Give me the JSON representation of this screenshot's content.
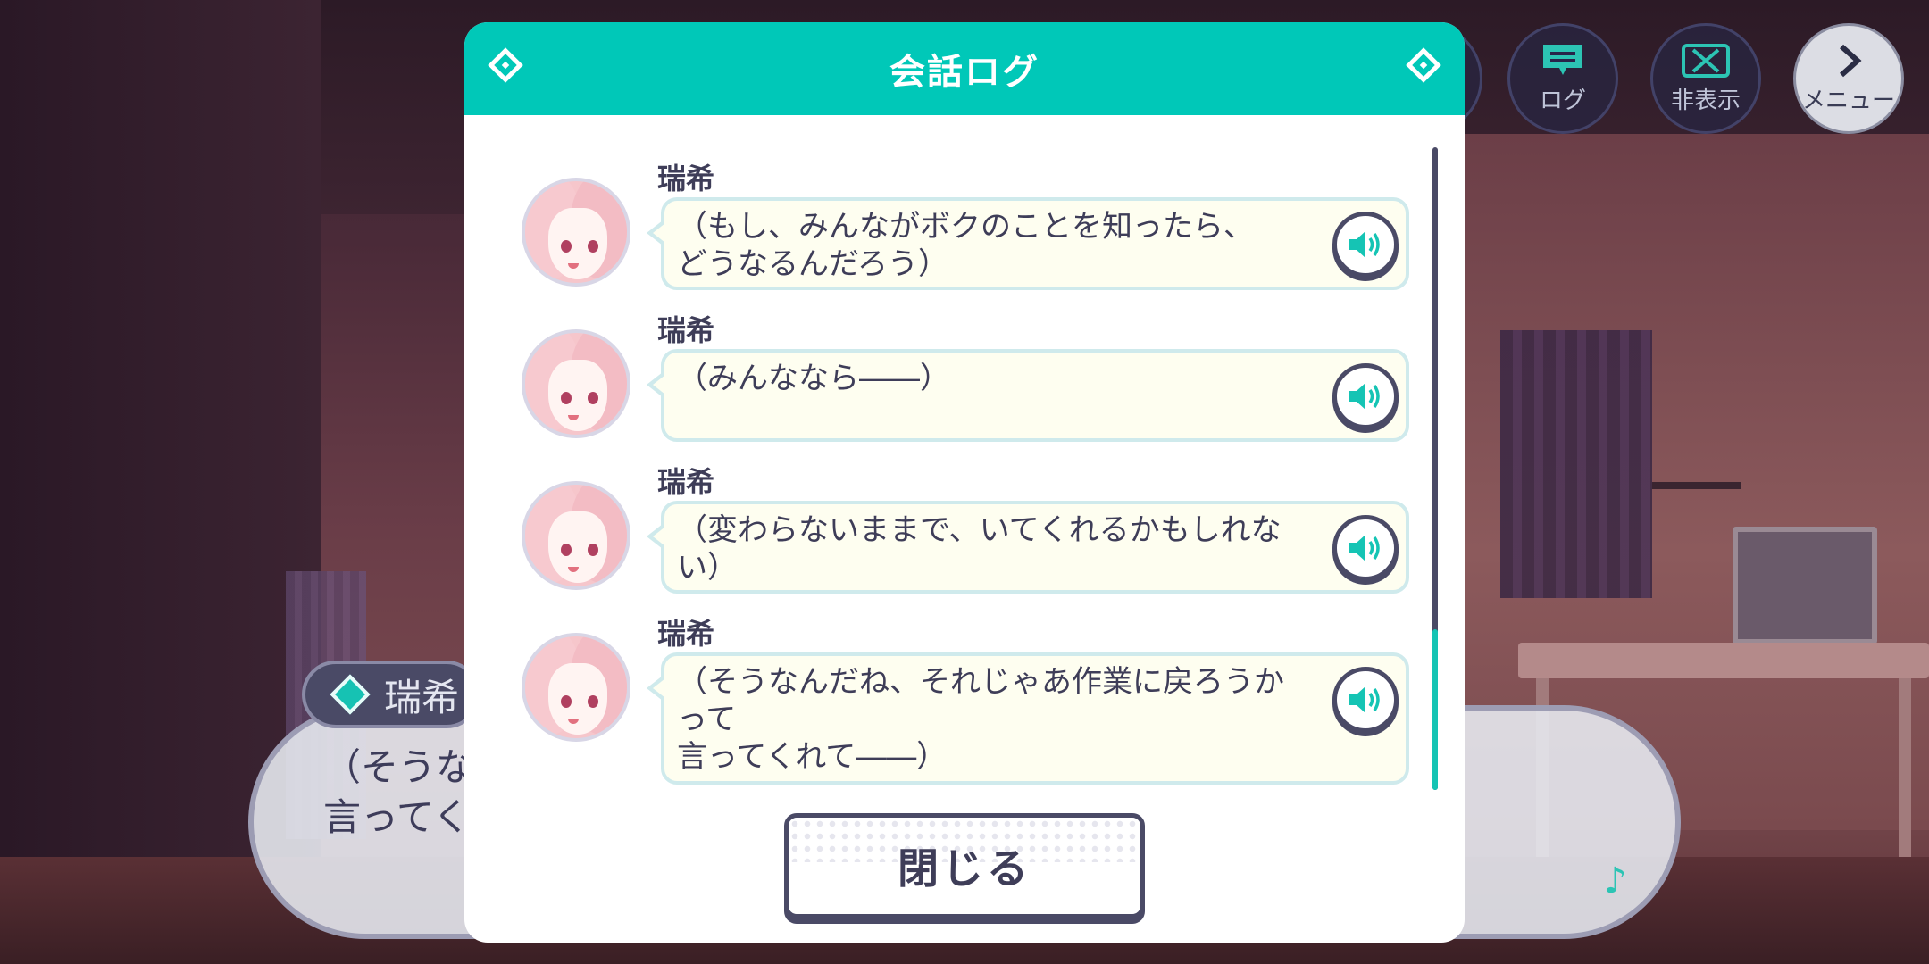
{
  "hud": {
    "log_label": "ログ",
    "hide_label": "非表示",
    "menu_label": "メニュー"
  },
  "message_box": {
    "speaker": "瑞希",
    "text": "（そうな\n言ってく"
  },
  "log_dialog": {
    "title": "会話ログ",
    "close_label": "閉じる",
    "entries": [
      {
        "speaker": "瑞希",
        "text": "（もし、みんながボクのことを知ったら、\nどうなるんだろう）",
        "voice_icon": "speaker-icon"
      },
      {
        "speaker": "瑞希",
        "text": "（みんななら――）",
        "voice_icon": "speaker-icon"
      },
      {
        "speaker": "瑞希",
        "text": "（変わらないままで、いてくれるかもしれな\nい）",
        "voice_icon": "speaker-icon"
      },
      {
        "speaker": "瑞希",
        "text": "（そうなんだね、それじゃあ作業に戻ろうか\nって\n言ってくれて――）",
        "voice_icon": "speaker-icon"
      }
    ]
  },
  "colors": {
    "accent": "#00c8b8",
    "text": "#3e3d58",
    "bubble_bg": "#fefef0",
    "bubble_border": "#cfeaec"
  }
}
